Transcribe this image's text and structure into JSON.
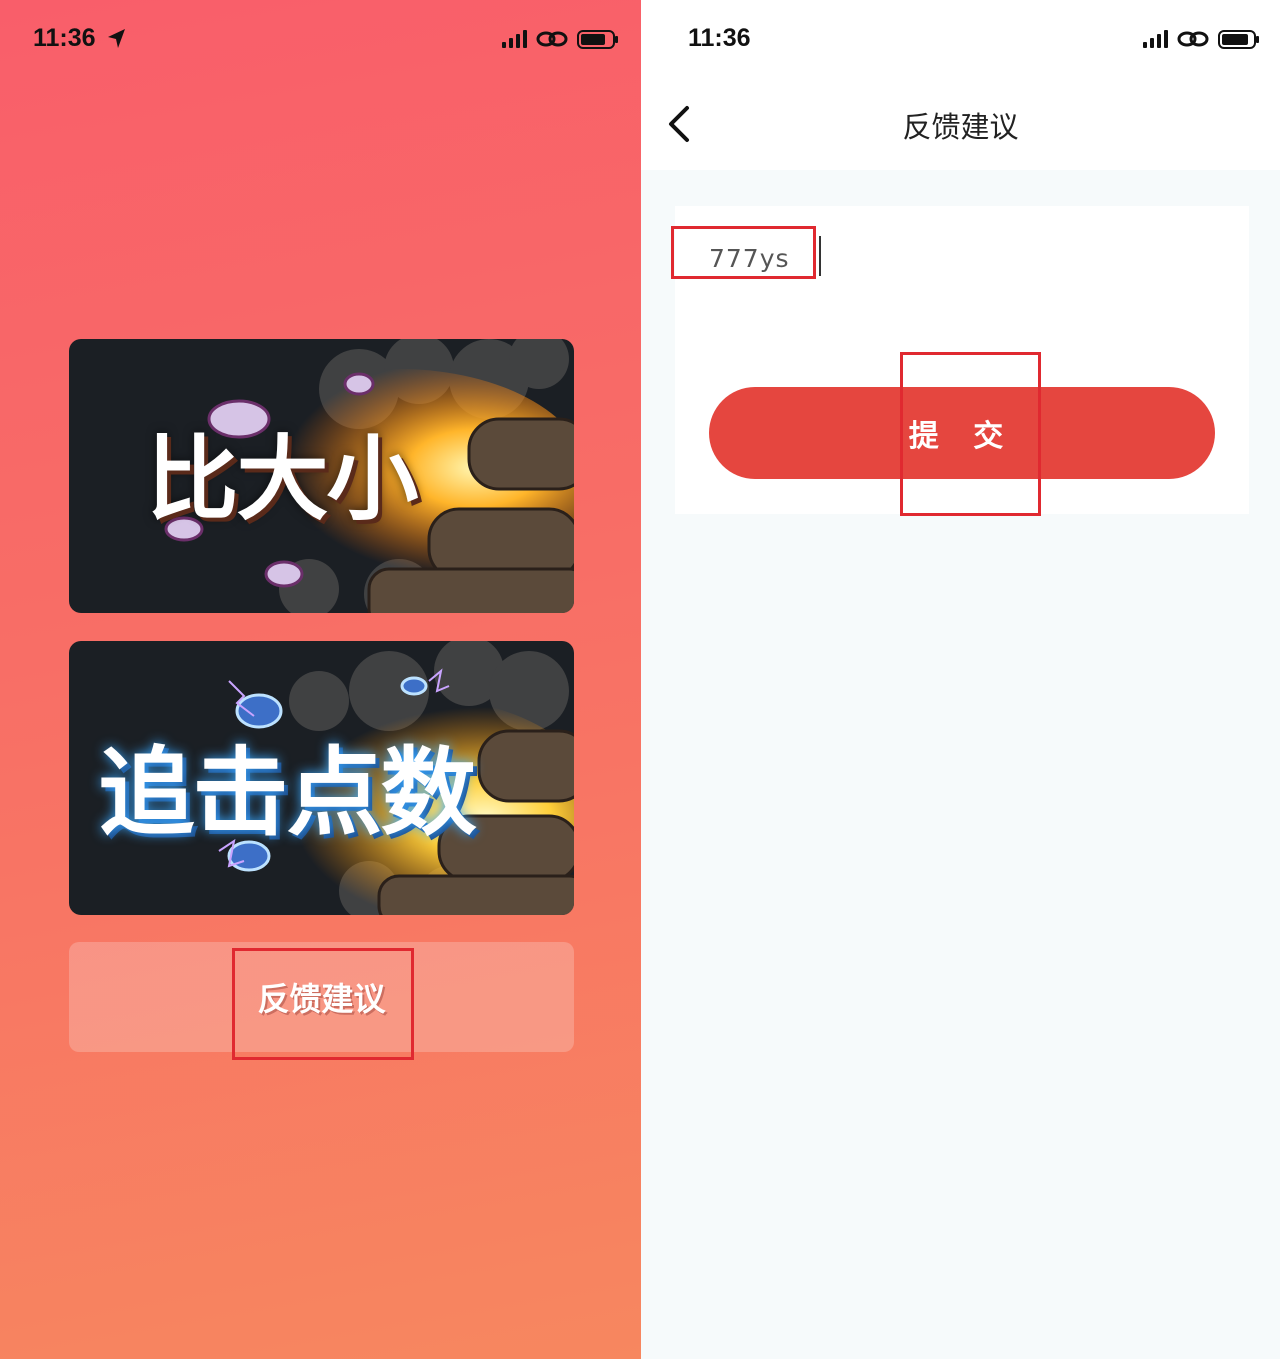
{
  "left_screen": {
    "status": {
      "time": "11:36"
    },
    "cards": [
      {
        "title": "比大小"
      },
      {
        "title": "追击点数"
      }
    ],
    "feedback_button_label": "反馈建议"
  },
  "right_screen": {
    "status": {
      "time": "11:36"
    },
    "nav": {
      "title": "反馈建议"
    },
    "input": {
      "value": "777ys"
    },
    "submit_label": "提 交"
  },
  "colors": {
    "left_gradient_top": "#f95e6a",
    "left_gradient_bottom": "#f7875f",
    "submit_button": "#e5463f",
    "highlight_box": "#e02930"
  }
}
